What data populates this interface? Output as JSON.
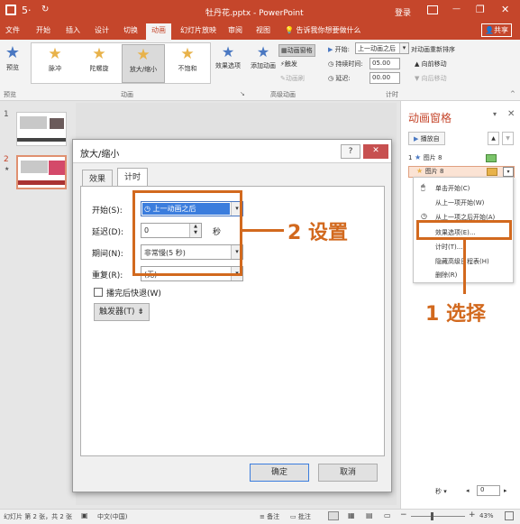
{
  "titlebar": {
    "undo": "5·",
    "redo": "↻",
    "doc_title": "牡丹花.pptx - PowerPoint",
    "login": "登录",
    "min": "—",
    "restore": "❐",
    "close": "✕"
  },
  "tabs": [
    "文件",
    "开始",
    "插入",
    "设计",
    "切换",
    "动画",
    "幻灯片放映",
    "审阅",
    "视图"
  ],
  "tell_me": "告诉我你想要做什么",
  "share": "共享",
  "ribbon": {
    "preview": "预览",
    "preview_group": "预览",
    "animations": [
      "脉冲",
      "陀螺旋",
      "放大/缩小",
      "不饱和"
    ],
    "animations_group": "动画",
    "effect_options": "效果选项",
    "add_animation": "添加动画",
    "anim_pane_btn": "动画窗格",
    "trigger": "触发",
    "anim_painter": "动画刷",
    "advanced_group": "高级动画",
    "start_label": "开始:",
    "start_value": "上一动画之后",
    "duration_label": "持续时间:",
    "duration_value": "05.00",
    "delay_label": "延迟:",
    "delay_value": "00.00",
    "reorder": "对动画重新排序",
    "move_earlier": "向前移动",
    "move_later": "向后移动",
    "timing_group": "计时"
  },
  "slides": [
    {
      "num": "1"
    },
    {
      "num": "2"
    }
  ],
  "pane": {
    "title": "动画窗格",
    "play": "播放自",
    "items": [
      {
        "num": "1",
        "label": "图片 8"
      },
      {
        "num": "",
        "label": "图片 8"
      }
    ],
    "menu": [
      "单击开始(C)",
      "从上一项开始(W)",
      "从上一项之后开始(A)",
      "效果选项(E)...",
      "计时(T)...",
      "隐藏高级日程表(H)",
      "删除(R)"
    ],
    "seconds": "秒"
  },
  "dialog": {
    "title": "放大/缩小",
    "help": "?",
    "close": "✕",
    "tabs": [
      "效果",
      "计时"
    ],
    "start_label": "开始(S):",
    "start_value": "上一动画之后",
    "delay_label": "延迟(D):",
    "delay_value": "0",
    "delay_unit": "秒",
    "period_label": "期间(N):",
    "period_value": "非常慢(5 秒)",
    "repeat_label": "重复(R):",
    "repeat_value": "(无)",
    "rewind_label": "播完后快退(W)",
    "trigger_btn": "触发器(T)",
    "ok": "确定",
    "cancel": "取消"
  },
  "callouts": {
    "step1": "1 选择",
    "step2": "2 设置"
  },
  "status": {
    "slide_info": "幻灯片 第 2 张，共 2 张",
    "lang": "中文(中国)",
    "notes": "备注",
    "comments": "批注",
    "zoom": "43%"
  },
  "colors": {
    "accent": "#c5462b",
    "highlight": "#d2691e"
  }
}
